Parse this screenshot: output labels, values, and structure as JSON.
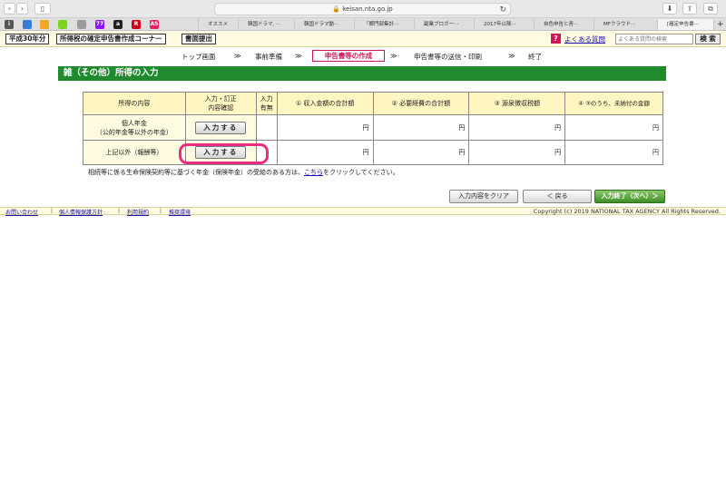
{
  "browser": {
    "url": "keisan.nta.go.jp",
    "tabs": [
      "オススメ",
      "韓国ドラマ, ···",
      "韓国ドラマ動···",
      "「郷門部集計···",
      "副業ブロガー···",
      "2017年以降···",
      "自色申告と青···",
      "MFクラウド···",
      "[確定申告書···"
    ],
    "favorites": [
      {
        "icon": "",
        "color": "#3a7bd5"
      },
      {
        "icon": "",
        "color": "#f5a623"
      },
      {
        "icon": "",
        "color": "#7ed321"
      },
      {
        "icon": "",
        "color": "#9b9b9b"
      },
      {
        "icon": "77",
        "color": "#9013fe"
      },
      {
        "icon": "a",
        "color": "#222222"
      },
      {
        "icon": "R",
        "color": "#d0021b"
      },
      {
        "icon": "AS",
        "color": "#e91e63"
      }
    ]
  },
  "header": {
    "year": "平成30年分",
    "corner": "所得税の確定申告書作成コーナー",
    "print": "書面提出",
    "faq": "よくある質問",
    "search_placeholder": "よくある質問の検索",
    "search_button": "検 索"
  },
  "steps": {
    "items": [
      "トップ画面",
      "事前準備",
      "申告書等の作成",
      "申告書等の送信・印刷",
      "終了"
    ],
    "arrow": "≫"
  },
  "title": "雑（その他）所得の入力",
  "table": {
    "headers": [
      "所得の内容",
      "入力・訂正\n内容確認",
      "入力\n有無",
      "① 収入金額の合計額",
      "② 必要経費の合計額",
      "③ 源泉徴収税額",
      "④ ③のうち、未納付の金額"
    ],
    "rows": [
      {
        "label": "個人年金\n（公的年金等以外の年金）",
        "button": "入力する",
        "unit": "円"
      },
      {
        "label": "上記以外（報酬等）",
        "button": "入力する",
        "unit": "円"
      }
    ]
  },
  "notice": {
    "before": "相続等に係る生命保険契約等に基づく年金（保険年金）の受給のある方は、",
    "link": "こちら",
    "after": "をクリックしてください。"
  },
  "actions": {
    "clear": "入力内容をクリア",
    "back": "＜ 戻る",
    "next": "入力終了（次へ）＞"
  },
  "footer": {
    "links": [
      "お問い合わせ",
      "個人情報保護方針",
      "利用規約",
      "推奨環境"
    ],
    "separator": "|",
    "copyright": "Copyright (c) 2019 NATIONAL TAX AGENCY All Rights Reserved."
  }
}
